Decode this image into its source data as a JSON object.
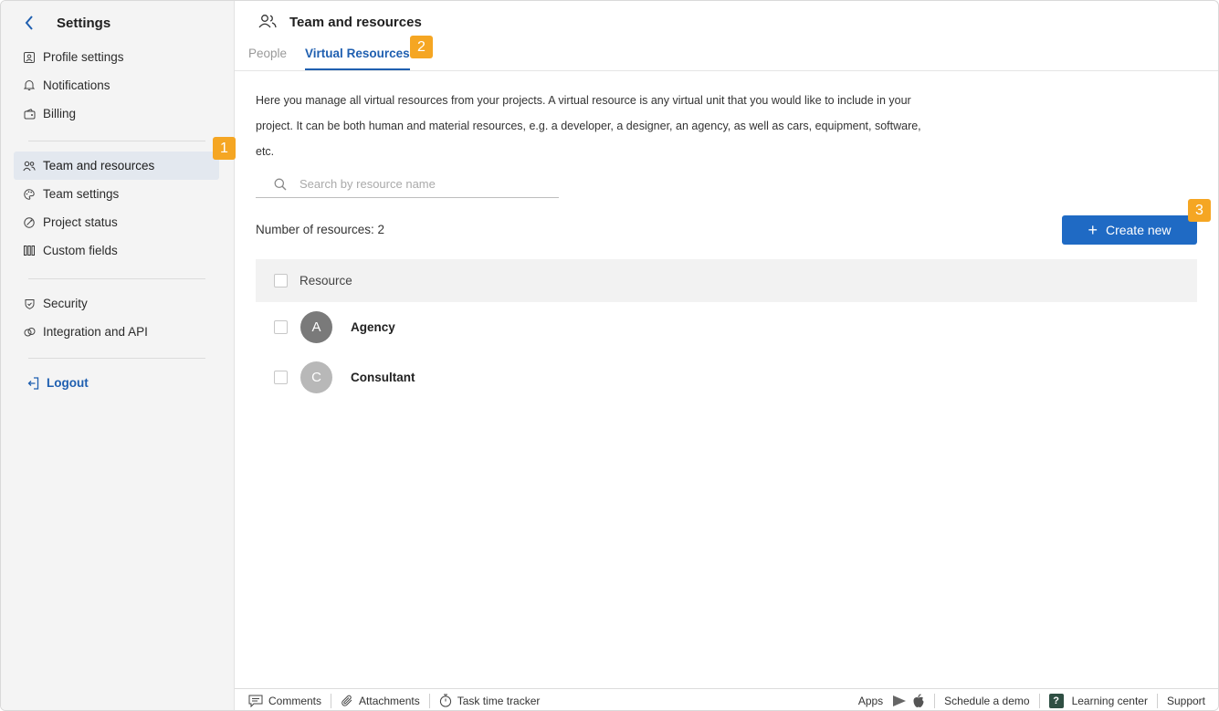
{
  "sidebar": {
    "title": "Settings",
    "group1": [
      {
        "label": "Profile settings",
        "icon": "profile-icon"
      },
      {
        "label": "Notifications",
        "icon": "bell-icon"
      },
      {
        "label": "Billing",
        "icon": "billing-icon"
      }
    ],
    "group2": [
      {
        "label": "Team and resources",
        "icon": "team-icon",
        "active": true
      },
      {
        "label": "Team settings",
        "icon": "palette-icon"
      },
      {
        "label": "Project status",
        "icon": "status-icon"
      },
      {
        "label": "Custom fields",
        "icon": "columns-icon"
      }
    ],
    "group3": [
      {
        "label": "Security",
        "icon": "shield-icon"
      },
      {
        "label": "Integration and API",
        "icon": "link-icon"
      }
    ],
    "logout": "Logout"
  },
  "markers": {
    "m1": "1",
    "m2": "2",
    "m3": "3"
  },
  "page": {
    "title": "Team and resources",
    "tabs": [
      {
        "label": "People",
        "active": false
      },
      {
        "label": "Virtual Resources",
        "active": true
      }
    ],
    "description": "Here you manage all virtual resources from your projects. A virtual resource is any virtual unit that you would like to include in your project. It can be both human and material resources, e.g. a developer, a designer, an agency, as well as cars, equipment, software, etc.",
    "search_placeholder": "Search by resource name",
    "count_label": "Number of resources: 2",
    "create_label": "Create new",
    "table": {
      "header": "Resource",
      "rows": [
        {
          "initial": "A",
          "name": "Agency",
          "color": "#7a7a7a"
        },
        {
          "initial": "C",
          "name": "Consultant",
          "color": "#b8b8b8"
        }
      ]
    }
  },
  "bottombar": {
    "comments": "Comments",
    "attachments": "Attachments",
    "tracker": "Task time tracker",
    "apps": "Apps",
    "demo": "Schedule a demo",
    "learning": "Learning center",
    "support": "Support"
  },
  "colors": {
    "accent": "#1f6ac4",
    "marker": "#f5a623",
    "active_bg": "#e3e8ef"
  }
}
